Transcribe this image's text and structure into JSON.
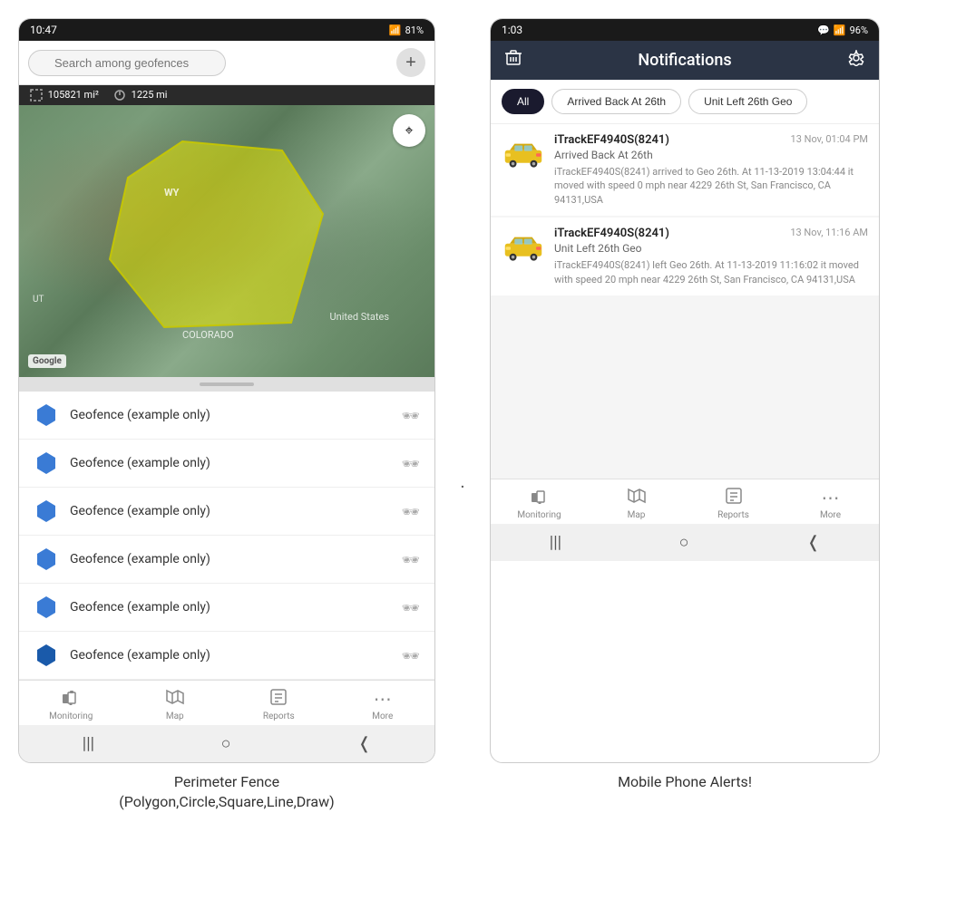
{
  "left_phone": {
    "status_bar": {
      "time": "10:47",
      "wifi": "wifi",
      "signal": "signal",
      "battery": "81%"
    },
    "search": {
      "placeholder": "Search among geofences"
    },
    "stats": {
      "area": "105821 mi²",
      "distance": "1225 mi"
    },
    "map": {
      "labels": {
        "wy": "WY",
        "united_states": "United States",
        "colorado": "COLORADO",
        "ut": "UT"
      },
      "google": "Google"
    },
    "geofence_items": [
      {
        "name": "Geofence (example only)"
      },
      {
        "name": "Geofence (example only)"
      },
      {
        "name": "Geofence (example only)"
      },
      {
        "name": "Geofence (example only)"
      },
      {
        "name": "Geofence (example only)"
      },
      {
        "name": "Geofence (example only)"
      }
    ],
    "nav": {
      "items": [
        {
          "label": "Monitoring",
          "icon": "bus"
        },
        {
          "label": "Map",
          "icon": "map"
        },
        {
          "label": "Reports",
          "icon": "reports"
        },
        {
          "label": "More",
          "icon": "more"
        }
      ]
    }
  },
  "right_phone": {
    "status_bar": {
      "time": "1:03",
      "chat": "chat",
      "wifi": "wifi",
      "signal": "signal",
      "battery": "96%"
    },
    "header": {
      "title": "Notifications",
      "delete_icon": "trash",
      "settings_icon": "gear"
    },
    "filter_tabs": [
      {
        "label": "All",
        "active": true
      },
      {
        "label": "Arrived Back At 26th",
        "active": false
      },
      {
        "label": "Unit Left 26th Geo",
        "active": false
      }
    ],
    "notifications": [
      {
        "device": "iTrackEF4940S(8241)",
        "time": "13 Nov, 01:04 PM",
        "event": "Arrived Back At 26th",
        "body": "iTrackEF4940S(8241) arrived to Geo 26th.   At 11-13-2019 13:04:44 it moved with speed 0 mph near 4229 26th St, San Francisco, CA 94131,USA"
      },
      {
        "device": "iTrackEF4940S(8241)",
        "time": "13 Nov, 11:16 AM",
        "event": "Unit Left 26th Geo",
        "body": "iTrackEF4940S(8241) left Geo 26th.   At 11-13-2019 11:16:02 it moved with speed 20 mph near 4229 26th St, San Francisco, CA 94131,USA"
      }
    ],
    "nav": {
      "items": [
        {
          "label": "Monitoring",
          "icon": "bus"
        },
        {
          "label": "Map",
          "icon": "map"
        },
        {
          "label": "Reports",
          "icon": "reports"
        },
        {
          "label": "More",
          "icon": "more"
        }
      ]
    }
  },
  "captions": {
    "left": "Perimeter Fence\n(Polygon,Circle,Square,Line,Draw)",
    "right": "Mobile Phone Alerts!"
  }
}
